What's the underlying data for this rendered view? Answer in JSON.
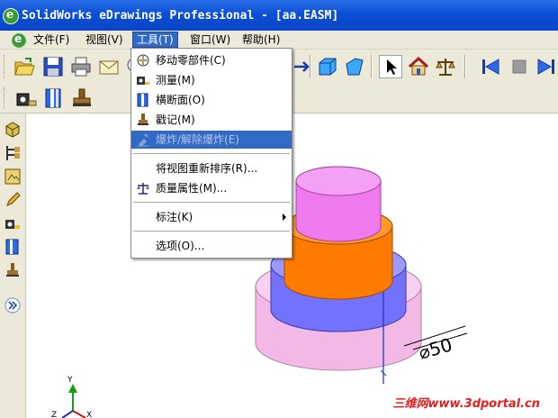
{
  "window": {
    "title": "SolidWorks eDrawings Professional - [aa.EASM]",
    "app_icon_letter": "e"
  },
  "menubar": {
    "items": [
      {
        "label": "文件(F)"
      },
      {
        "label": "视图(V)"
      },
      {
        "label": "工具(T)"
      },
      {
        "label": "窗口(W)"
      },
      {
        "label": "帮助(H)"
      }
    ]
  },
  "tools_menu": {
    "items": [
      {
        "label": "移动零部件(C)",
        "icon": "move-component-icon"
      },
      {
        "label": "测量(M)",
        "icon": "measure-icon"
      },
      {
        "label": "横断面(O)",
        "icon": "section-icon"
      },
      {
        "label": "戳记(M)",
        "icon": "stamp-icon"
      },
      {
        "label": "爆炸/解除爆炸(E)",
        "icon": "explode-icon",
        "disabled": true,
        "highlighted": true
      },
      {
        "label": "将视图重新排序(R)...",
        "icon": ""
      },
      {
        "label": "质量属性(M)...",
        "icon": "mass-properties-icon"
      },
      {
        "label": "标注(K)",
        "icon": "",
        "submenu": true
      },
      {
        "label": "选项(O)...",
        "icon": ""
      }
    ]
  },
  "viewport": {
    "dimension_text": "⌀50",
    "triad_labels": {
      "y": "Y",
      "z": "Z",
      "x": "X"
    }
  },
  "watermark": "三维网www.3dportal.cn",
  "colors": {
    "titlebar": "#0b4fd6",
    "highlight": "#316ac5",
    "cylinder_top": "#ee88ee",
    "cylinder_mid": "#ff7a00",
    "cylinder_blue": "#7070ff",
    "cylinder_base": "#f4b8e8",
    "watermark": "#e02020"
  }
}
